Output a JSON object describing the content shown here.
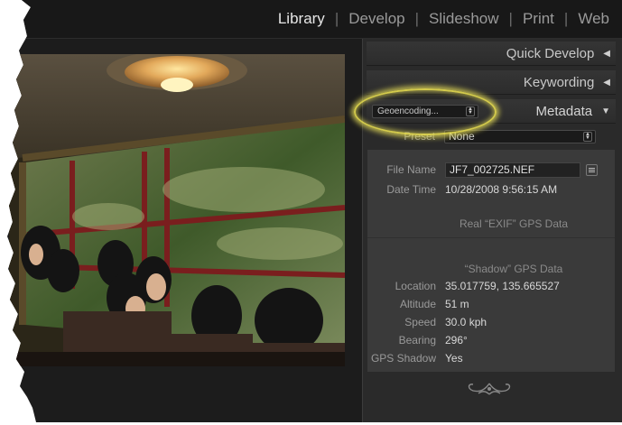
{
  "nav": {
    "items": [
      "Library",
      "Develop",
      "Slideshow",
      "Print",
      "Web"
    ],
    "active": "Library"
  },
  "panel": {
    "quick_develop": "Quick Develop",
    "keywording": "Keywording",
    "metadata": "Metadata",
    "metadata_set": "Geoencoding...",
    "preset_label": "Preset",
    "preset_value": "None",
    "fields": {
      "file_name_label": "File Name",
      "file_name": "JF7_002725.NEF",
      "date_time_label": "Date Time",
      "date_time": "10/28/2008 9:56:15 AM",
      "exif_gps_heading": "Real “EXIF” GPS Data",
      "shadow_gps_heading": "“Shadow” GPS Data",
      "location_label": "Location",
      "location": "35.017759, 135.665527",
      "altitude_label": "Altitude",
      "altitude": "51 m",
      "speed_label": "Speed",
      "speed": "30.0 kph",
      "bearing_label": "Bearing",
      "bearing": "296°",
      "gps_shadow_label": "GPS Shadow",
      "gps_shadow": "Yes"
    }
  },
  "colors": {
    "highlight_ring": "#e6dc50",
    "panel_bg": "#2a2a2a",
    "nav_active": "#e6e6e6"
  }
}
